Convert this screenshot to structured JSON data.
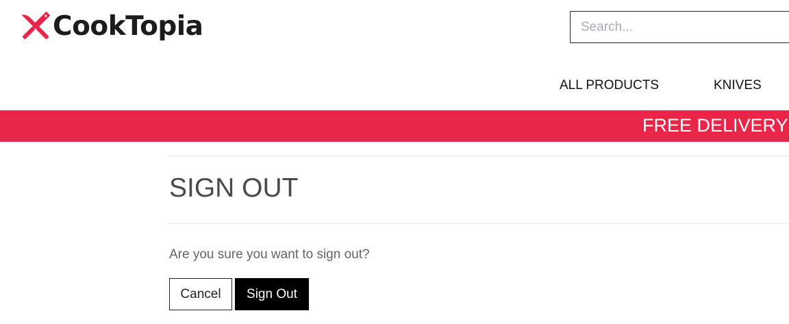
{
  "brand": {
    "name": "CookTopia",
    "accent_color": "#e8264a",
    "logo_icon": "crossed-knives-icon"
  },
  "search": {
    "placeholder": "Search...",
    "value": ""
  },
  "nav": {
    "items": [
      {
        "label": "ALL PRODUCTS"
      },
      {
        "label": "KNIVES"
      }
    ]
  },
  "banner": {
    "text": "FREE DELIVERY"
  },
  "main": {
    "title": "SIGN OUT",
    "message": "Are you sure you want to sign out?",
    "cancel_label": "Cancel",
    "signout_label": "Sign Out"
  }
}
